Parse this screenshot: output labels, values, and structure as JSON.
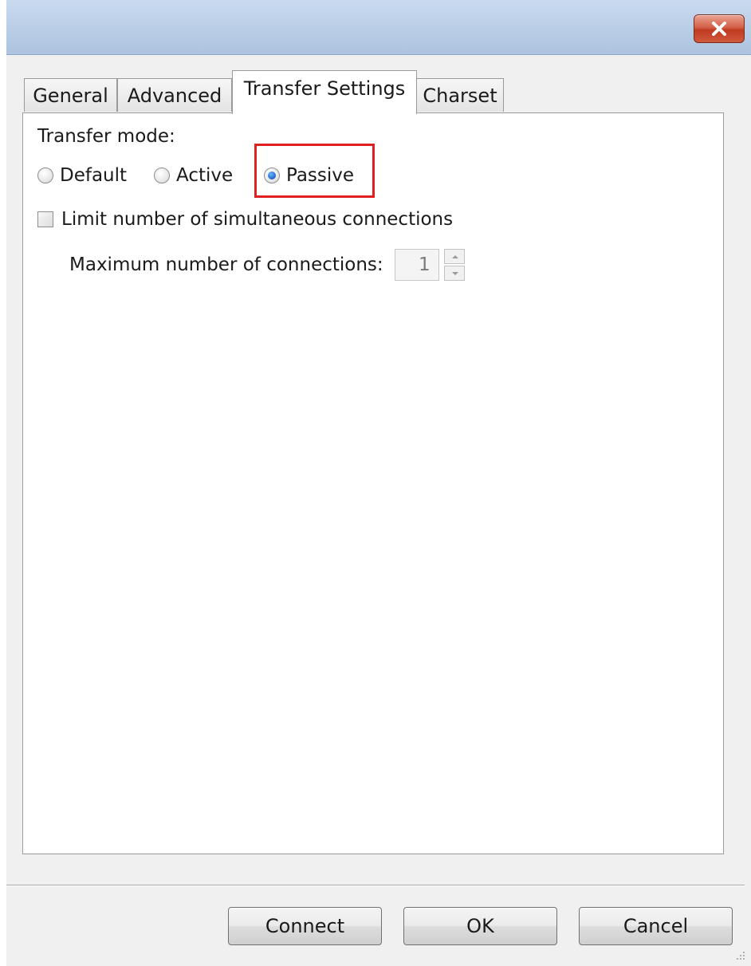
{
  "window": {
    "close_label": "✕"
  },
  "tabs": [
    {
      "label": "General",
      "active": false
    },
    {
      "label": "Advanced",
      "active": false
    },
    {
      "label": "Transfer Settings",
      "active": true
    },
    {
      "label": "Charset",
      "active": false
    }
  ],
  "transfer": {
    "mode_label": "Transfer mode:",
    "modes": [
      {
        "label": "Default",
        "checked": false
      },
      {
        "label": "Active",
        "checked": false
      },
      {
        "label": "Passive",
        "checked": true
      }
    ],
    "limit_label": "Limit number of simultaneous connections",
    "limit_checked": false,
    "max_label": "Maximum number of connections:",
    "max_value": "1"
  },
  "buttons": {
    "connect": "Connect",
    "ok": "OK",
    "cancel": "Cancel"
  },
  "colors": {
    "highlight": "#e02020",
    "radio_selected": "#1d63c9"
  },
  "icons": {
    "close": "close-icon",
    "spin_up": "chevron-up-icon",
    "spin_down": "chevron-down-icon",
    "resize_grip": "resize-grip-icon"
  }
}
